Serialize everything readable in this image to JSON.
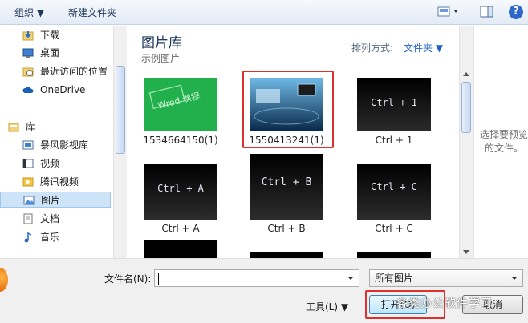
{
  "toolbar": {
    "organize": "组织 ▼",
    "new_folder": "新建文件夹"
  },
  "nav": {
    "items": [
      {
        "label": "下载",
        "icon": "download-folder-icon"
      },
      {
        "label": "桌面",
        "icon": "desktop-icon"
      },
      {
        "label": "最近访问的位置",
        "icon": "recent-places-icon"
      },
      {
        "label": "OneDrive",
        "icon": "cloud-icon"
      },
      {
        "label": "库",
        "icon": "library-icon"
      },
      {
        "label": "暴风影视库",
        "icon": "video-library-icon"
      },
      {
        "label": "视频",
        "icon": "video-icon"
      },
      {
        "label": "腾讯视频",
        "icon": "tencent-video-icon"
      },
      {
        "label": "图片",
        "icon": "pictures-icon"
      },
      {
        "label": "文档",
        "icon": "documents-icon"
      },
      {
        "label": "音乐",
        "icon": "music-icon"
      }
    ]
  },
  "main": {
    "title": "图片库",
    "subtitle": "示例图片",
    "sort_label": "排列方式:",
    "sort_value": "文件夹 ▼",
    "files": [
      {
        "caption": "1534664150(1)"
      },
      {
        "caption": "1550413241(1)"
      },
      {
        "caption": "Ctrl + 1",
        "thumb_text": "Ctrl + 1"
      },
      {
        "caption": "Ctrl + A",
        "thumb_text": "Ctrl + A"
      },
      {
        "caption": "Ctrl + B",
        "thumb_text": "Ctrl + B"
      },
      {
        "caption": "Ctrl + C",
        "thumb_text": "Ctrl + C"
      }
    ],
    "green_thumb_text": "Wrod 课程"
  },
  "preview": {
    "text": "选择要预览的文件。"
  },
  "bottom": {
    "filename_label": "文件名(N):",
    "filename_value": "",
    "file_type": "所有图片",
    "tools_label": "工具(L) ▼",
    "open_label": "打开(O)",
    "cancel_label": "取消",
    "watermark": "各类办公软件学习"
  },
  "colors": {
    "accent": "#1e60c8",
    "highlight_box": "#e0302c",
    "selected_nav": "#cde3f8"
  }
}
